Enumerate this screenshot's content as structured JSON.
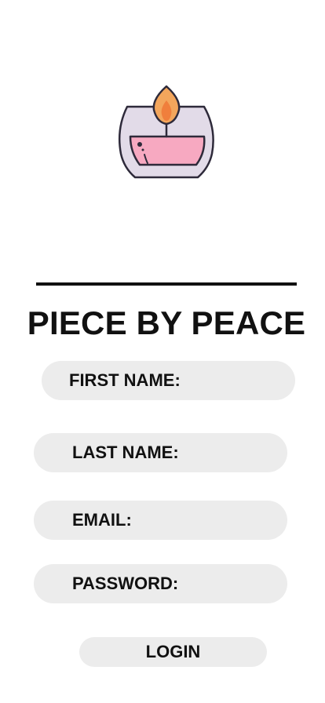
{
  "app": {
    "title": "PIECE BY PEACE",
    "logo_icon": "candle-icon"
  },
  "form": {
    "first_name_label": "FIRST NAME:",
    "first_name_value": "",
    "last_name_label": "LAST NAME:",
    "last_name_value": "",
    "email_label": "EMAIL:",
    "email_value": "",
    "password_label": "PASSWORD:",
    "password_value": "",
    "login_label": "LOGIN"
  },
  "colors": {
    "background": "#ffffff",
    "text": "#111111",
    "field_bg": "#ececec",
    "candle_jar": "#e2dbe8",
    "candle_wax": "#f7a9c1",
    "flame_outer": "#f3a65c",
    "flame_inner": "#f07f3c"
  }
}
